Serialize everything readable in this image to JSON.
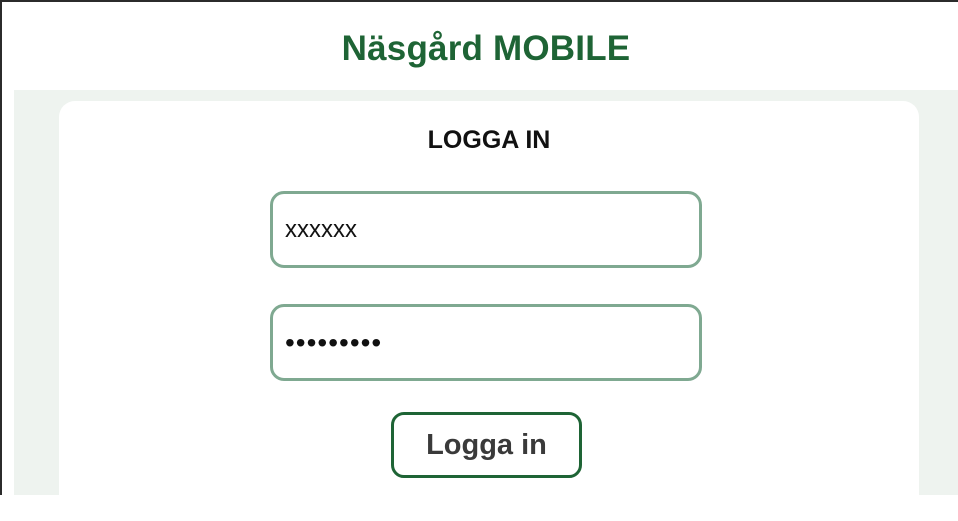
{
  "app": {
    "title": "Näsgård MOBILE"
  },
  "login": {
    "heading": "LOGGA IN",
    "username_value": "xxxxxx",
    "password_value": "*********",
    "submit_label": "Logga in"
  },
  "colors": {
    "brand_green": "#1e6435",
    "input_border": "#7fa991",
    "background": "#eef3ef"
  }
}
